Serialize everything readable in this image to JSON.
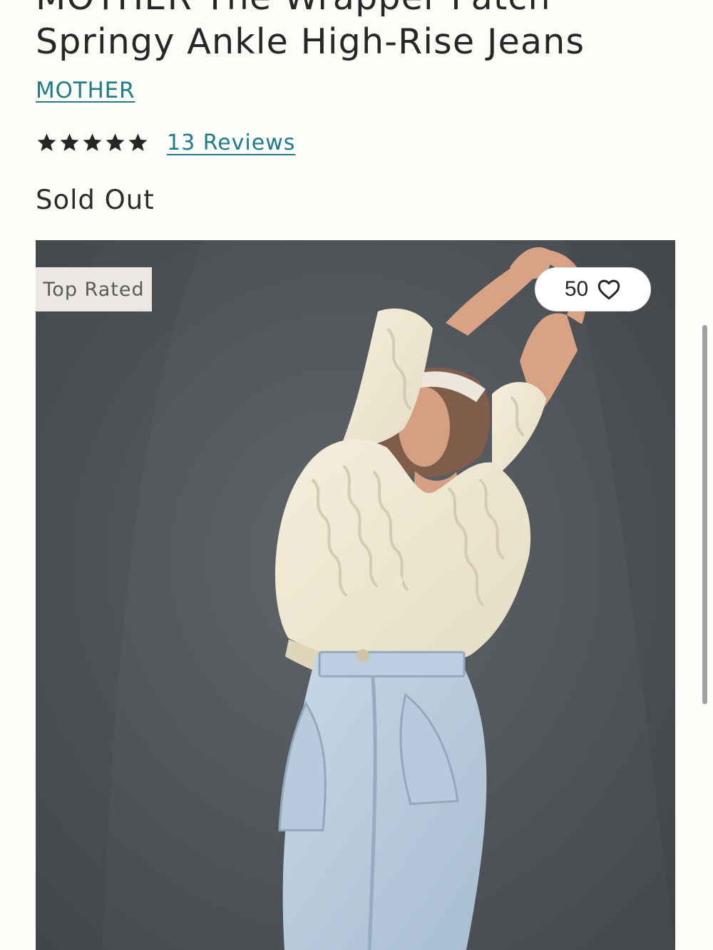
{
  "product": {
    "title_line1": "MOTHER The Wrapper Patch",
    "title_line2": "Springy Ankle High-Rise Jeans",
    "brand": "MOTHER",
    "rating": 5,
    "rating_max": 5,
    "reviews_label": "13 Reviews",
    "status": "Sold Out"
  },
  "image": {
    "badge": "Top Rated",
    "favorites_count": "50"
  },
  "icons": {
    "rating": "star-icon",
    "favorite": "heart-outline-icon"
  },
  "colors": {
    "background": "#fcfcf8",
    "text": "#2b2b2b",
    "link": "#207c88",
    "badge_background": "#ebe8e3"
  }
}
